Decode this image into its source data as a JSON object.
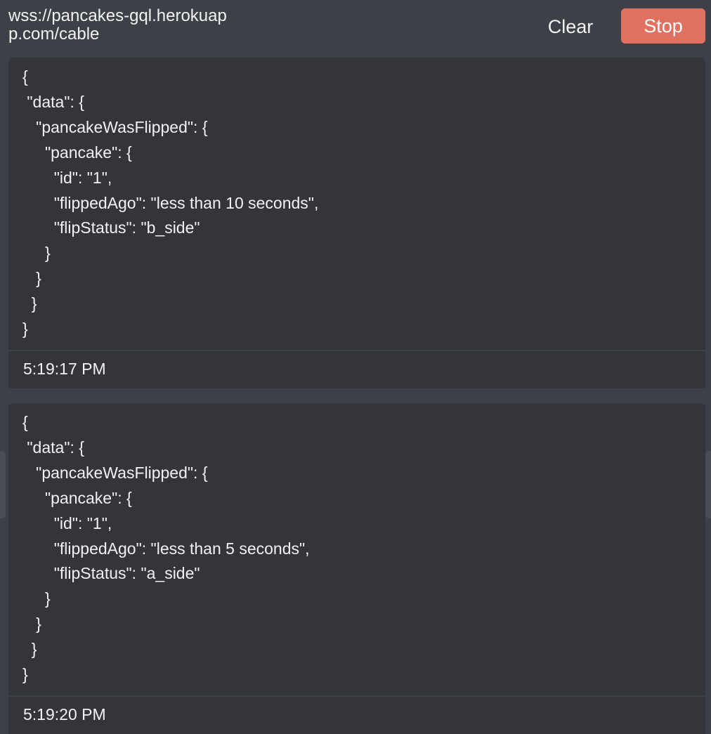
{
  "connection": {
    "url": "wss://pancakes-gql.herokuapp.com/cable"
  },
  "toolbar": {
    "clear_label": "Clear",
    "stop_label": "Stop",
    "stop_color": "#e07060"
  },
  "messages": [
    {
      "payload": "{\n \"data\": {\n   \"pancakeWasFlipped\": {\n     \"pancake\": {\n       \"id\": \"1\",\n       \"flippedAgo\": \"less than 10 seconds\",\n       \"flipStatus\": \"b_side\"\n     }\n   }\n  }\n}",
      "timestamp": "5:19:17 PM"
    },
    {
      "payload": "{\n \"data\": {\n   \"pancakeWasFlipped\": {\n     \"pancake\": {\n       \"id\": \"1\",\n       \"flippedAgo\": \"less than 5 seconds\",\n       \"flipStatus\": \"a_side\"\n     }\n   }\n  }\n}",
      "timestamp": "5:19:20 PM"
    }
  ]
}
